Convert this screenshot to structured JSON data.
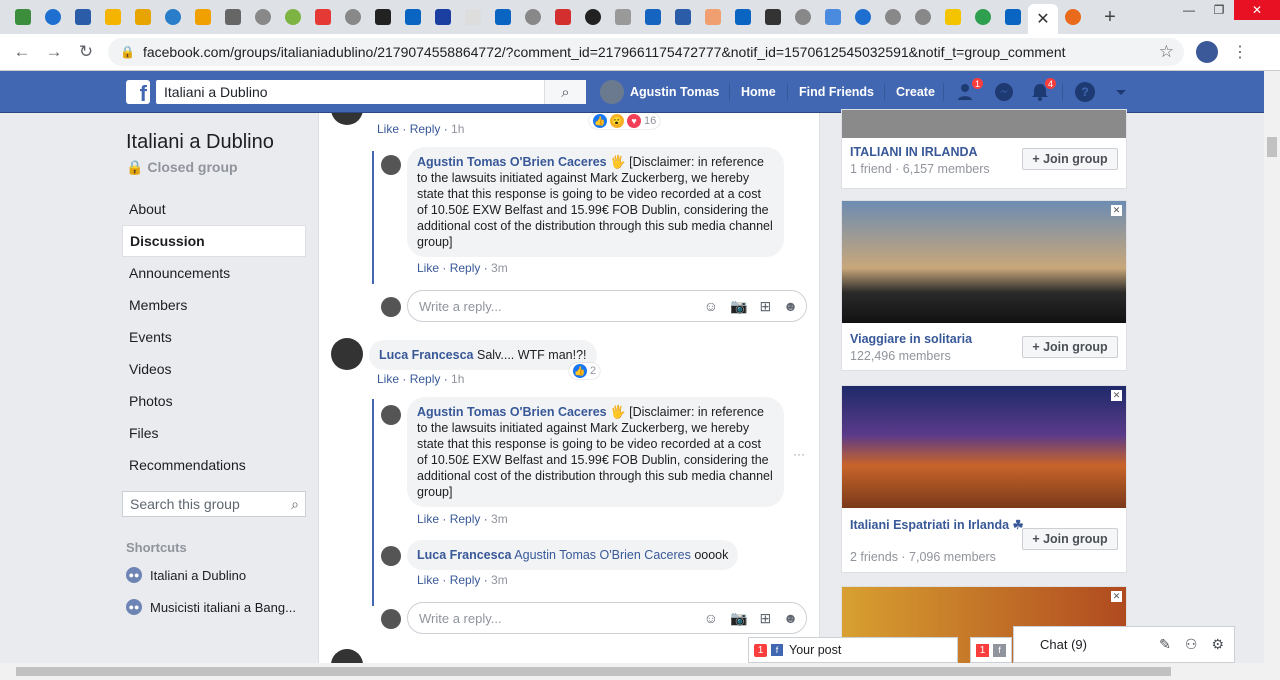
{
  "browser": {
    "active_tab_close": "✕",
    "new_tab": "+",
    "url": "facebook.com/groups/italianiadublino/2179074558864772/?comment_id=2179661175472777&notif_id=1570612545032591&notif_t=group_comment"
  },
  "fb_header": {
    "search_value": "Italiani a Dublino",
    "user_name": "Agustin Tomas",
    "nav_home": "Home",
    "nav_find_friends": "Find Friends",
    "nav_create": "Create",
    "friend_requests_badge": "1",
    "notifications_badge": "4",
    "accent_color": "#4267b2"
  },
  "left": {
    "group_title": "Italiani a Dublino",
    "group_privacy": "Closed group",
    "nav": [
      "About",
      "Discussion",
      "Announcements",
      "Members",
      "Events",
      "Videos",
      "Photos",
      "Files",
      "Recommendations"
    ],
    "active_nav": "Discussion",
    "search_placeholder": "Search this group",
    "shortcuts_heading": "Shortcuts",
    "shortcuts": [
      "Italiani a Dublino",
      "Musicisti italiani a Bang..."
    ]
  },
  "comments": {
    "top_actions": {
      "like": "Like",
      "reply": "Reply",
      "time": "1h",
      "reaction_count": "16"
    },
    "reply1": {
      "author": "Agustin Tomas O'Brien Caceres",
      "text": "🖐 [Disclaimer: in reference to the lawsuits initiated against Mark Zuckerberg, we hereby state that this response is going to be video recorded at a cost of 10.50£ EXW Belfast and 15.99€ FOB Dublin, considering the additional cost of the distribution through this sub media channel group]",
      "like": "Like",
      "reply": "Reply",
      "time": "3m"
    },
    "reply_placeholder": "Write a reply...",
    "luca": {
      "author": "Luca Francesca",
      "text": "Salv.... WTF man!?!",
      "like": "Like",
      "reply": "Reply",
      "time": "1h",
      "reaction_count": "2"
    },
    "reply2": {
      "author": "Agustin Tomas O'Brien Caceres",
      "text": "🖐 [Disclaimer: in reference to the lawsuits initiated against Mark Zuckerberg, we hereby state that this response is going to be video recorded at a cost of 10.50£ EXW Belfast and 15.99€ FOB Dublin, considering the additional cost of the distribution through this sub media channel group]",
      "like": "Like",
      "reply": "Reply",
      "time": "3m"
    },
    "reply3": {
      "author": "Luca Francesca",
      "mention": "Agustin Tomas O'Brien Caceres",
      "text": "ooook",
      "like": "Like",
      "reply": "Reply",
      "time": "3m"
    },
    "more_options": "···"
  },
  "suggestions": [
    {
      "name": "ITALIANI IN IRLANDA",
      "meta": "1 friend · 6,157 members",
      "join": "Join group"
    },
    {
      "name": "Viaggiare in solitaria",
      "meta": "122,496 members",
      "join": "Join group"
    },
    {
      "name": "Italiani Espatriati in Irlanda ☘",
      "meta": "2 friends · 7,096 members",
      "join": "Join group"
    }
  ],
  "chat": {
    "label": "Chat (9)",
    "post_tab": "Your post",
    "post_count": "1",
    "post2_count": "1"
  }
}
